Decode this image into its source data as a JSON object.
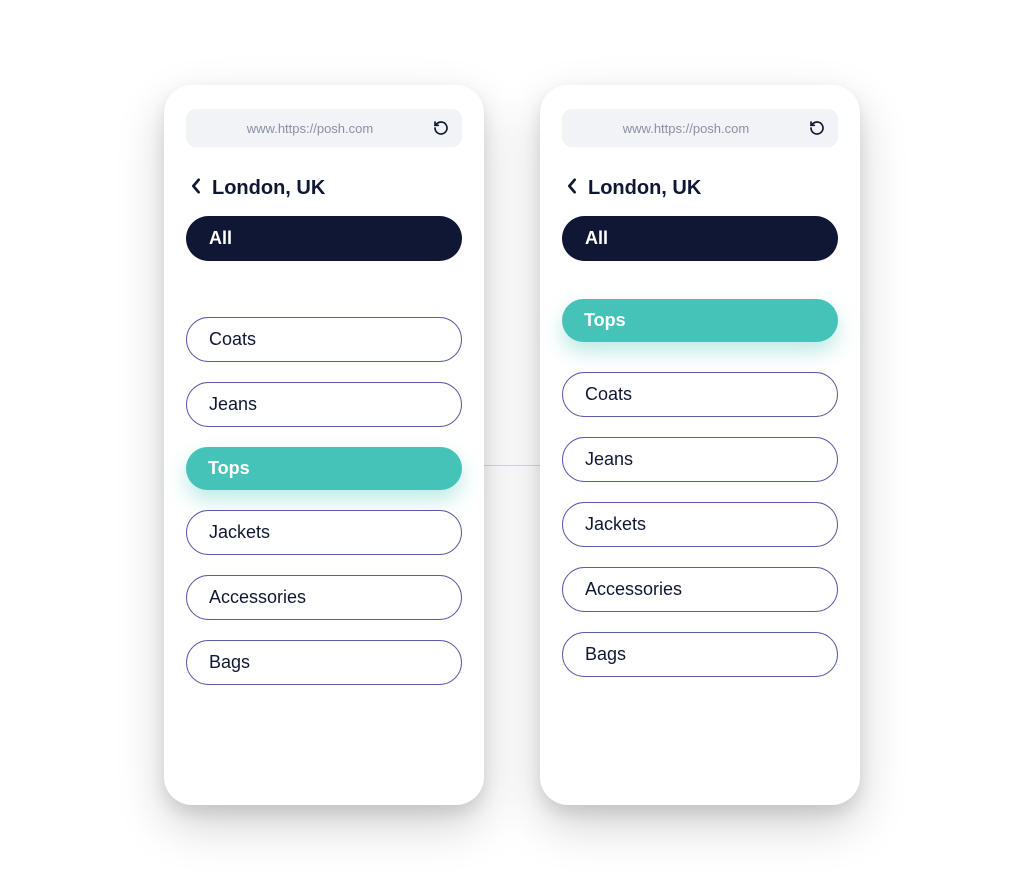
{
  "url": "www.https://posh.com",
  "location": "London, UK",
  "allLabel": "All",
  "screenA": {
    "items": [
      {
        "label": "Coats",
        "selected": false
      },
      {
        "label": "Jeans",
        "selected": false
      },
      {
        "label": "Tops",
        "selected": true
      },
      {
        "label": "Jackets",
        "selected": false
      },
      {
        "label": "Accessories",
        "selected": false
      },
      {
        "label": "Bags",
        "selected": false
      }
    ]
  },
  "screenB": {
    "selectedTop": "Tops",
    "items": [
      {
        "label": "Coats",
        "selected": false
      },
      {
        "label": "Jeans",
        "selected": false
      },
      {
        "label": "Jackets",
        "selected": false
      },
      {
        "label": "Accessories",
        "selected": false
      },
      {
        "label": "Bags",
        "selected": false
      }
    ]
  }
}
